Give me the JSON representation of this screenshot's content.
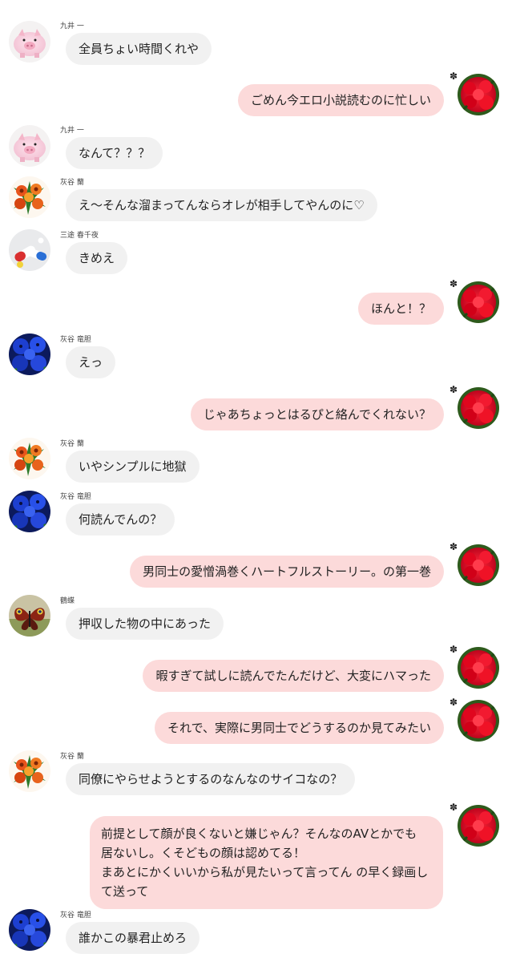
{
  "users": {
    "kokonoi": "九井 一",
    "ran": "灰谷 蘭",
    "sanzu": "三途 春千夜",
    "rindo": "灰谷 竜胆",
    "kakucho": "鶴蝶"
  },
  "self_marker": "✽",
  "messages": [
    {
      "text": "全員ちょい時間くれや"
    },
    {
      "text": "ごめん今エロ小説読むのに忙しい"
    },
    {
      "text": "なんて？？？"
    },
    {
      "text": "え〜そんな溜まってんならオレが相手してやんのに♡"
    },
    {
      "text": "きめえ"
    },
    {
      "text": "ほんと！？"
    },
    {
      "text": "えっ"
    },
    {
      "text": "じゃあちょっとはるぴと絡んでくれない？"
    },
    {
      "text": "いやシンプルに地獄"
    },
    {
      "text": "何読んでんの？"
    },
    {
      "text": "男同士の愛憎渦巻くハートフルストーリー。の第一巻"
    },
    {
      "text": "押収した物の中にあった"
    },
    {
      "text": "暇すぎて試しに読んでたんだけど、大変にハマった"
    },
    {
      "text": "それで、実際に男同士でどうするのか見てみたい"
    },
    {
      "text": "同僚にやらせようとするのなんなのサイコなの？"
    },
    {
      "lines": [
        "前提として顔が良くないと嫌じゃん？そんなのAVとかでも",
        "居ないし。くそどもの顔は認めてる！",
        "まあとにかくいいから私が見たいって言ってん の早く録画し",
        "て送って"
      ]
    },
    {
      "text": "誰かこの暴君止めろ"
    }
  ]
}
